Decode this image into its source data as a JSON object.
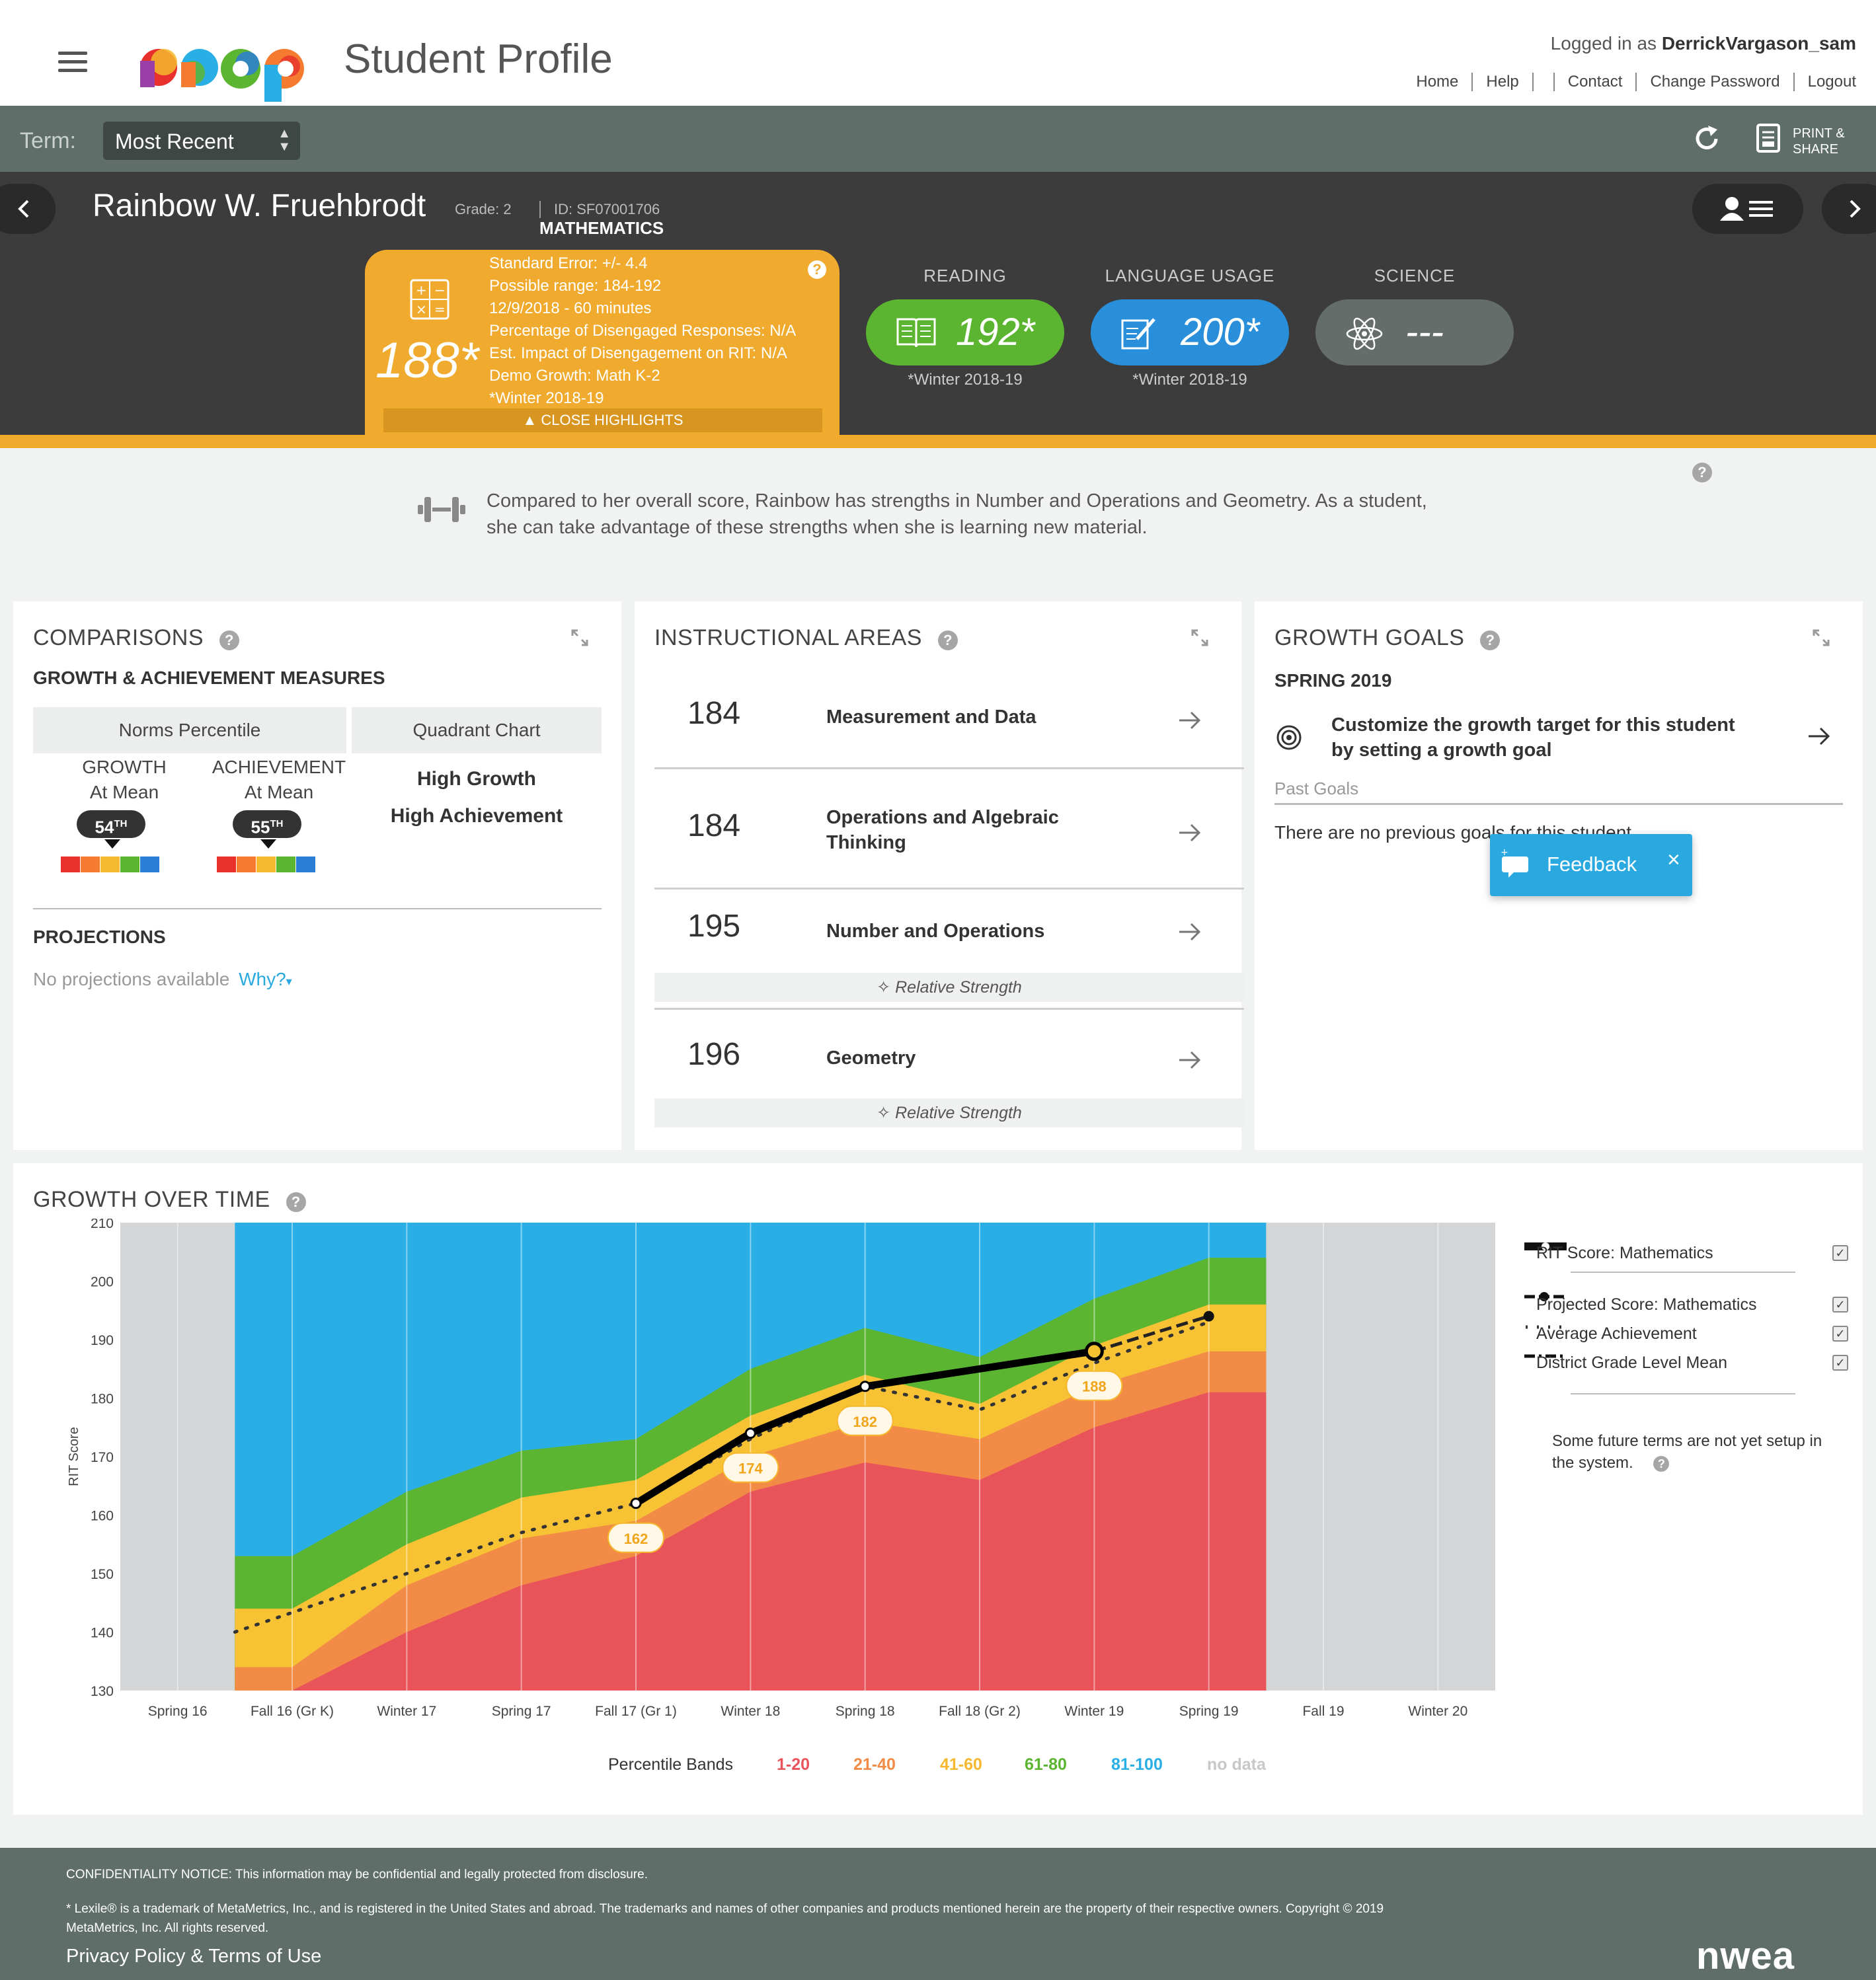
{
  "header": {
    "title": "Student Profile",
    "login_prefix": "Logged in as",
    "username": "DerrickVargason_sam",
    "links": [
      "Home",
      "Help",
      "Contact",
      "Change Password",
      "Logout"
    ]
  },
  "termbar": {
    "label": "Term:",
    "selected": "Most Recent",
    "print_line1": "PRINT &",
    "print_line2": "SHARE"
  },
  "student": {
    "name": "Rainbow W. Fruehbrodt",
    "grade": "Grade: 2",
    "id": "ID: SF07001706",
    "subject": "MATHEMATICS"
  },
  "math_card": {
    "score": "188*",
    "lines": [
      "Standard Error: +/- 4.4",
      "Possible range: 184-192",
      "12/9/2018 - 60 minutes",
      "Percentage of Disengaged Responses: N/A",
      "Est. Impact of Disengagement on RIT: N/A",
      "Demo Growth: Math K-2",
      "*Winter 2018-19"
    ],
    "close_label": "CLOSE HIGHLIGHTS",
    "help": "?"
  },
  "subjects": [
    {
      "title": "READING",
      "score": "192*",
      "term": "*Winter 2018-19",
      "color": "#5cb531",
      "icon": "book-icon"
    },
    {
      "title": "LANGUAGE USAGE",
      "score": "200*",
      "term": "*Winter 2018-19",
      "color": "#2a8fdb",
      "icon": "pencil-paper-icon"
    },
    {
      "title": "SCIENCE",
      "score": "---",
      "term": "",
      "color": "#646d6a",
      "icon": "atom-icon"
    }
  ],
  "strength_message": "Compared to her overall score, Rainbow has strengths in Number and Operations and Geometry. As a student, she can take advantage of these strengths when she is learning new material.",
  "comparisons": {
    "title": "COMPARISONS",
    "subtitle": "GROWTH & ACHIEVEMENT MEASURES",
    "norms_tab": "Norms Percentile",
    "quad_tab": "Quadrant Chart",
    "growth_label1": "GROWTH",
    "growth_label2": "At Mean",
    "growth_pct": "54",
    "ach_label1": "ACHIEVEMENT",
    "ach_label2": "At Mean",
    "ach_pct": "55",
    "pct_suffix": "TH",
    "quad_line1": "High Growth",
    "quad_line2": "High Achievement",
    "projections_title": "PROJECTIONS",
    "projections_text": "No projections available",
    "why": "Why?",
    "band_colors": [
      "#e8312d",
      "#f47b30",
      "#f5b82e",
      "#5cb531",
      "#2a7ed6"
    ]
  },
  "instructional": {
    "title": "INSTRUCTIONAL AREAS",
    "areas": [
      {
        "score": "184",
        "name1": "Measurement and Data",
        "name2": "",
        "strength": ""
      },
      {
        "score": "184",
        "name1": "Operations and Algebraic",
        "name2": "Thinking",
        "strength": ""
      },
      {
        "score": "195",
        "name1": "Number and Operations",
        "name2": "",
        "strength": "Relative Strength"
      },
      {
        "score": "196",
        "name1": "Geometry",
        "name2": "",
        "strength": "Relative Strength"
      }
    ]
  },
  "growth_goals": {
    "title": "GROWTH GOALS",
    "term": "SPRING 2019",
    "cta1": "Customize the growth target for this student",
    "cta2": "by setting a growth goal",
    "past_label": "Past Goals",
    "past_text": "There are no previous goals for this student."
  },
  "feedback": {
    "label": "Feedback"
  },
  "growth_over_time": {
    "title": "GROWTH OVER TIME",
    "legend": [
      "RIT Score: Mathematics",
      "Projected Score: Mathematics",
      "Average Achievement",
      "District Grade Level Mean"
    ],
    "note1": "Some future terms are not yet setup in",
    "note2": "the system.",
    "bands_label": "Percentile Bands",
    "bands": [
      {
        "label": "1-20",
        "color": "#e8545a"
      },
      {
        "label": "21-40",
        "color": "#f28b45"
      },
      {
        "label": "41-60",
        "color": "#f7c335"
      },
      {
        "label": "61-80",
        "color": "#5cb531"
      },
      {
        "label": "81-100",
        "color": "#2aaee6"
      },
      {
        "label": "no data",
        "color": "#c8c8c8"
      }
    ]
  },
  "chart_data": {
    "type": "area",
    "ylabel": "RIT Score",
    "ylim": [
      130,
      210
    ],
    "yticks": [
      130,
      140,
      150,
      160,
      170,
      180,
      190,
      200,
      210
    ],
    "categories": [
      "Spring 16",
      "Fall 16 (Gr K)",
      "Winter 17",
      "Spring 17",
      "Fall 17 (Gr 1)",
      "Winter 18",
      "Spring 18",
      "Fall 18 (Gr 2)",
      "Winter 19",
      "Spring 19",
      "Fall 19",
      "Winter 20"
    ],
    "data_range": [
      1,
      9
    ],
    "band_upper_bounds": {
      "1-20": [
        null,
        130,
        140,
        148,
        153,
        164,
        169,
        166,
        175,
        181,
        null,
        null
      ],
      "21-40": [
        null,
        134,
        148,
        156,
        159,
        170,
        176,
        173,
        182,
        188,
        null,
        null
      ],
      "41-60": [
        null,
        144,
        155,
        163,
        166,
        177,
        184,
        179,
        189,
        196,
        null,
        null
      ],
      "61-80": [
        null,
        153,
        164,
        171,
        173,
        185,
        192,
        187,
        197,
        204,
        null,
        null
      ],
      "81-100": [
        null,
        210,
        210,
        210,
        210,
        210,
        210,
        210,
        210,
        210,
        null,
        null
      ]
    },
    "series": [
      {
        "name": "RIT Score: Mathematics",
        "values": [
          null,
          null,
          null,
          null,
          162,
          174,
          182,
          null,
          188,
          null,
          null,
          null
        ]
      },
      {
        "name": "Projected Score: Mathematics",
        "values": [
          null,
          null,
          null,
          null,
          null,
          null,
          null,
          null,
          188,
          194,
          null,
          null
        ]
      },
      {
        "name": "Average Achievement",
        "values": [
          null,
          140,
          150,
          157,
          162,
          173,
          182,
          178,
          186,
          193,
          null,
          null
        ]
      }
    ],
    "point_labels": [
      "162",
      "174",
      "182",
      "188"
    ],
    "grid": true,
    "legend": "right"
  },
  "footer": {
    "notice": "CONFIDENTIALITY NOTICE: This information may be confidential and legally protected from disclosure.",
    "legal": "* Lexile® is a trademark of MetaMetrics, Inc., and is registered in the United States and abroad. The trademarks and names of other companies and products mentioned herein are the property of their respective owners. Copyright © 2019 MetaMetrics, Inc. All rights reserved.",
    "privacy": "Privacy Policy & Terms of Use",
    "brand": "nwea"
  }
}
